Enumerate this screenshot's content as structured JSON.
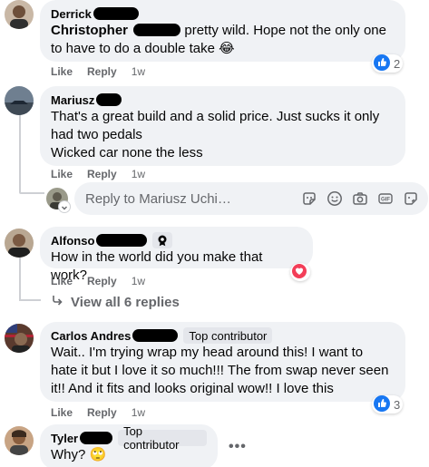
{
  "comments": [
    {
      "author": "Derrick",
      "mention": "Christopher",
      "text": "pretty wild. Hope not the only one to have to do a double take 😂",
      "like": "Like",
      "reply": "Reply",
      "time": "1w",
      "reaction_count": "2",
      "reaction_icon": "thumbs-up-icon"
    },
    {
      "author": "Mariusz",
      "text_lines": [
        "That's a great build and a solid price. Just sucks it only had two pedals",
        "Wicked car none the less"
      ],
      "like": "Like",
      "reply": "Reply",
      "time": "1w"
    },
    {
      "author": "Alfonso",
      "author_badge_icon": "top-fan-icon",
      "text": "How in the world did you make that work?",
      "like": "Like",
      "reply": "Reply",
      "time": "1w",
      "reaction_icon": "heart-icon",
      "view_replies": "View all 6 replies"
    },
    {
      "author": "Carlos Andres",
      "badge": "Top contributor",
      "text": "Wait.. I'm trying wrap my head around this! I want to hate it but I love it so much!!! The from swap never seen it!! And it fits and looks original wow!! I love this",
      "like": "Like",
      "reply": "Reply",
      "time": "1w",
      "reaction_count": "3",
      "reaction_icon": "thumbs-up-icon"
    },
    {
      "author": "Tyler",
      "badge": "Top contributor",
      "text": "Why? 🙄",
      "more_icon": "more-horizontal-icon"
    }
  ],
  "reply_box": {
    "placeholder": "Reply to Mariusz Uchi…",
    "icons": [
      "sticker-icon",
      "emoji-icon",
      "camera-icon",
      "gif-icon",
      "avatar-sticker-icon"
    ]
  },
  "colors": {
    "bubble": "#f0f2f5",
    "secondary_text": "#65676b",
    "like_blue": "#1877f2",
    "love_red": "#f33e58",
    "redaction": "#000000"
  }
}
